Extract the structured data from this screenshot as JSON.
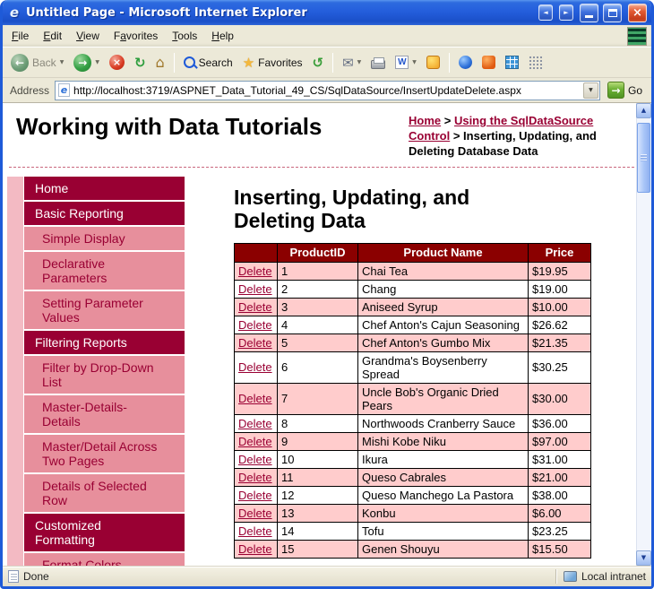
{
  "window": {
    "title": "Untitled Page - Microsoft Internet Explorer",
    "status": {
      "left": "Done",
      "zone": "Local intranet"
    }
  },
  "menu": {
    "items": [
      {
        "label": "File",
        "mnemonic_index": 0
      },
      {
        "label": "Edit",
        "mnemonic_index": 0
      },
      {
        "label": "View",
        "mnemonic_index": 0
      },
      {
        "label": "Favorites",
        "mnemonic_index": 1
      },
      {
        "label": "Tools",
        "mnemonic_index": 0
      },
      {
        "label": "Help",
        "mnemonic_index": 0
      }
    ]
  },
  "toolbar": {
    "back_label": "Back",
    "search_label": "Search",
    "favorites_label": "Favorites"
  },
  "address_bar": {
    "label": "Address",
    "url": "http://localhost:3719/ASPNET_Data_Tutorial_49_CS/SqlDataSource/InsertUpdateDelete.aspx",
    "go_label": "Go"
  },
  "page": {
    "site_title": "Working with Data Tutorials",
    "breadcrumb": {
      "separator": ">",
      "segments": [
        {
          "label": "Home",
          "link": true
        },
        {
          "label": "Using the SqlDataSource Control",
          "link": true
        },
        {
          "label": "Inserting, Updating, and Deleting Database Data",
          "link": false
        }
      ]
    },
    "heading": "Inserting, Updating, and Deleting Data",
    "sidebar": {
      "items": [
        {
          "label": "Home",
          "level": "top"
        },
        {
          "label": "Basic Reporting",
          "level": "top"
        },
        {
          "label": "Simple Display",
          "level": "sub"
        },
        {
          "label": "Declarative Parameters",
          "level": "sub"
        },
        {
          "label": "Setting Parameter Values",
          "level": "sub"
        },
        {
          "label": "Filtering Reports",
          "level": "top"
        },
        {
          "label": "Filter by Drop-Down List",
          "level": "sub"
        },
        {
          "label": "Master-Details-Details",
          "level": "sub"
        },
        {
          "label": "Master/Detail Across Two Pages",
          "level": "sub"
        },
        {
          "label": "Details of Selected Row",
          "level": "sub"
        },
        {
          "label": "Customized Formatting",
          "level": "top"
        },
        {
          "label": "Format Colors",
          "level": "sub"
        }
      ]
    },
    "products_table": {
      "headers": [
        "",
        "ProductID",
        "Product Name",
        "Price"
      ],
      "delete_label": "Delete",
      "rows": [
        {
          "id": "1",
          "name": "Chai Tea",
          "price": "$19.95"
        },
        {
          "id": "2",
          "name": "Chang",
          "price": "$19.00"
        },
        {
          "id": "3",
          "name": "Aniseed Syrup",
          "price": "$10.00"
        },
        {
          "id": "4",
          "name": "Chef Anton's Cajun Seasoning",
          "price": "$26.62"
        },
        {
          "id": "5",
          "name": "Chef Anton's Gumbo Mix",
          "price": "$21.35"
        },
        {
          "id": "6",
          "name": "Grandma's Boysenberry Spread",
          "price": "$30.25"
        },
        {
          "id": "7",
          "name": "Uncle Bob's Organic Dried Pears",
          "price": "$30.00"
        },
        {
          "id": "8",
          "name": "Northwoods Cranberry Sauce",
          "price": "$36.00"
        },
        {
          "id": "9",
          "name": "Mishi Kobe Niku",
          "price": "$97.00"
        },
        {
          "id": "10",
          "name": "Ikura",
          "price": "$31.00"
        },
        {
          "id": "11",
          "name": "Queso Cabrales",
          "price": "$21.00"
        },
        {
          "id": "12",
          "name": "Queso Manchego La Pastora",
          "price": "$38.00"
        },
        {
          "id": "13",
          "name": "Konbu",
          "price": "$6.00"
        },
        {
          "id": "14",
          "name": "Tofu",
          "price": "$23.25"
        },
        {
          "id": "15",
          "name": "Genen Shouyu",
          "price": "$15.50"
        }
      ]
    }
  },
  "icons": {
    "ie_logo": "e",
    "back_arrow": "←",
    "forward_arrow": "→",
    "dropdown_caret": "▼",
    "stop_x": "×",
    "refresh_arrows": "↻",
    "home_house": "⌂",
    "favorites_star": "★",
    "history_arrow": "↺",
    "mail_envelope": "✉",
    "edit_w": "W",
    "go_arrow": "→",
    "close_x": "×",
    "window_nav_left": "◄",
    "window_nav_right": "►",
    "scroll_up": "▲",
    "scroll_down": "▼"
  },
  "colors": {
    "maroon": "#990033",
    "sub_pink": "#E78F9C",
    "gutter_pink": "#F3BAC3",
    "row_pink": "#FFCCCC",
    "table_header_maroon": "#8B0000",
    "win_border": "#1E5AD8"
  }
}
